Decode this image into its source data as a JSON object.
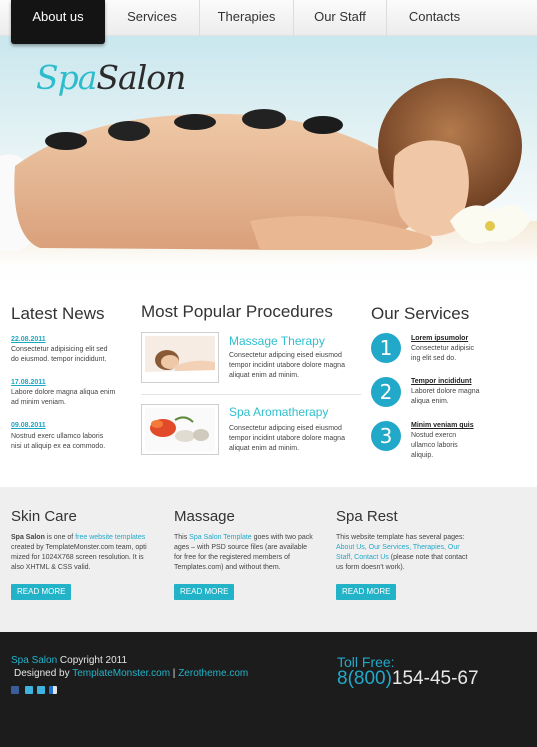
{
  "nav": {
    "items": [
      {
        "label": "About us",
        "active": true
      },
      {
        "label": "Services"
      },
      {
        "label": "Therapies"
      },
      {
        "label": "Our Staff"
      },
      {
        "label": "Contacts"
      }
    ]
  },
  "hero": {
    "logo_spa": "Spa",
    "logo_salon": "Salon"
  },
  "news": {
    "title": "Latest News",
    "items": [
      {
        "date": "22.08.2011",
        "text_1": "Consectetur adipisicing elit sed",
        "text_2": "do eiusmod. tempor incididunt."
      },
      {
        "date": "17.08.2011",
        "text_1": "Labore dolore magna aliqua enim",
        "text_2": "ad minim veniam."
      },
      {
        "date": "09.08.2011",
        "text_1": "Nostrud exerc ullamco laboris",
        "text_2": "nisi ut aliquip ex ea commodo."
      }
    ]
  },
  "procedures": {
    "title": "Most Popular Procedures",
    "items": [
      {
        "title": "Massage Therapy",
        "text_1": "Consectetur adipcing eised eiusmod",
        "text_2": "tempor incidint utabore dolore magna",
        "text_3": "aliquat enim ad minim."
      },
      {
        "title": "Spa Aromatherapy",
        "text_1": "Consectetur adipcing eised eiusmod",
        "text_2": "tempor incidint utabore dolore magna",
        "text_3": "aliquat enim ad minim."
      }
    ]
  },
  "services": {
    "title": "Our Services",
    "items": [
      {
        "num": "1",
        "link": "Lorem ipsumolor",
        "text_1": "Consectetur adipisic",
        "text_2": "ing elit sed do."
      },
      {
        "num": "2",
        "link": "Tempor incididunt",
        "text_1": "Laboret dolore magna",
        "text_2": "aliqua enim."
      },
      {
        "num": "3",
        "link": "Minim veniam quis",
        "text_1": "Nostud exercn",
        "text_2": "ullamco laboris",
        "text_3": "aliquip."
      }
    ]
  },
  "band": {
    "cols": [
      {
        "title": "Skin Care",
        "l1_a": "Spa Salon",
        "l1_b": " is one of ",
        "l1_c": "free website templates",
        "l2": "created by TemplateMonster.com team, opti",
        "l3": "mized for 1024X768 screen resolution. It is",
        "l4": "also XHTML & CSS valid.",
        "button": "READ MORE"
      },
      {
        "title": "Massage",
        "l1_a": "This ",
        "l1_b": "Spa Salon Template",
        "l1_c": " goes with two pack",
        "l2": "ages – with PSD source files (are available",
        "l3": "for free for the registered members of",
        "l4": "Templates.com) and without them.",
        "button": "READ MORE"
      },
      {
        "title": "Spa Rest",
        "l1": "This website template has several pages:",
        "l2_a": "About Us, Our Services, Therapies, Our",
        "l3_a": "Staff, Contact Us",
        "l3_b": " (please note that contact",
        "l4": "us form doesn't work).",
        "button": "READ MORE"
      }
    ]
  },
  "footer": {
    "brand": "Spa Salon",
    "copyright": " Copyright 2011",
    "designed_by": "Designed by ",
    "tm_link": "TemplateMonster.com",
    "sep": " | ",
    "zt_link": "Zerotheme.com",
    "toll_label": "Toll Free:",
    "phone_prefix": "8(800)",
    "phone_number": "154-45-67",
    "social": [
      "facebook-icon",
      "twitter-icon",
      "twitter-icon",
      "delicious-icon"
    ]
  }
}
